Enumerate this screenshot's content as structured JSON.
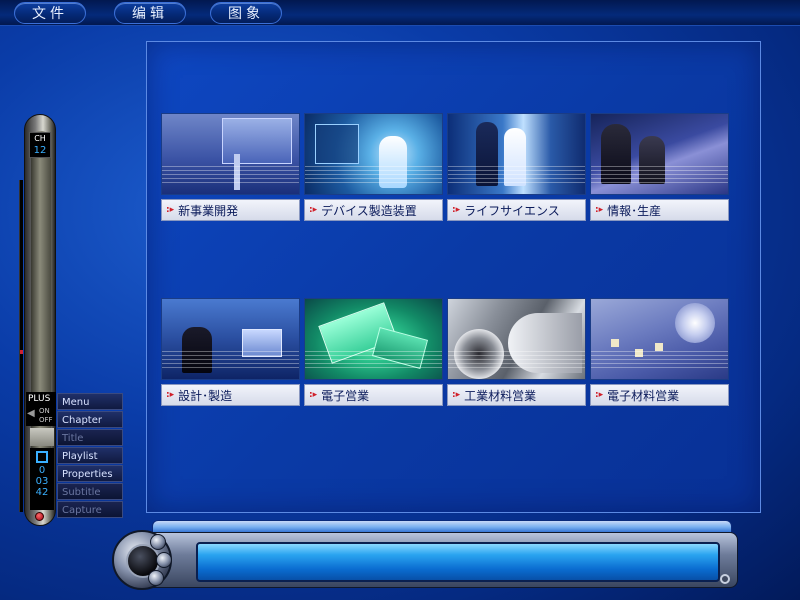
{
  "menubar": {
    "items": [
      {
        "label": "文件"
      },
      {
        "label": "编辑"
      },
      {
        "label": "图象"
      }
    ]
  },
  "thumbnails": [
    {
      "label": "新事業開発"
    },
    {
      "label": "デバイス製造装置"
    },
    {
      "label": "ライフサイエンス"
    },
    {
      "label": "情報･生産"
    },
    {
      "label": "設計･製造"
    },
    {
      "label": "電子営業"
    },
    {
      "label": "工業材料営業"
    },
    {
      "label": "電子材料営業"
    }
  ],
  "remote": {
    "ch_label": "CH",
    "ch_value": "12",
    "plus_label": "PLUS",
    "on_label": "ON",
    "off_label": "OFF",
    "counter_1": "0",
    "counter_2": "03",
    "counter_3": "42"
  },
  "side_menu": {
    "items": [
      {
        "label": "Menu",
        "enabled": true
      },
      {
        "label": "Chapter",
        "enabled": true
      },
      {
        "label": "Title",
        "enabled": false
      },
      {
        "label": "Playlist",
        "enabled": true
      },
      {
        "label": "Properties",
        "enabled": true
      },
      {
        "label": "Subtitle",
        "enabled": false
      },
      {
        "label": "Capture",
        "enabled": false
      }
    ]
  },
  "colors": {
    "background": "#0a3ca8",
    "panel_border": "#5c8ae4",
    "label_arrow": "#d0202a",
    "display_blue": "#3ab0ff"
  }
}
